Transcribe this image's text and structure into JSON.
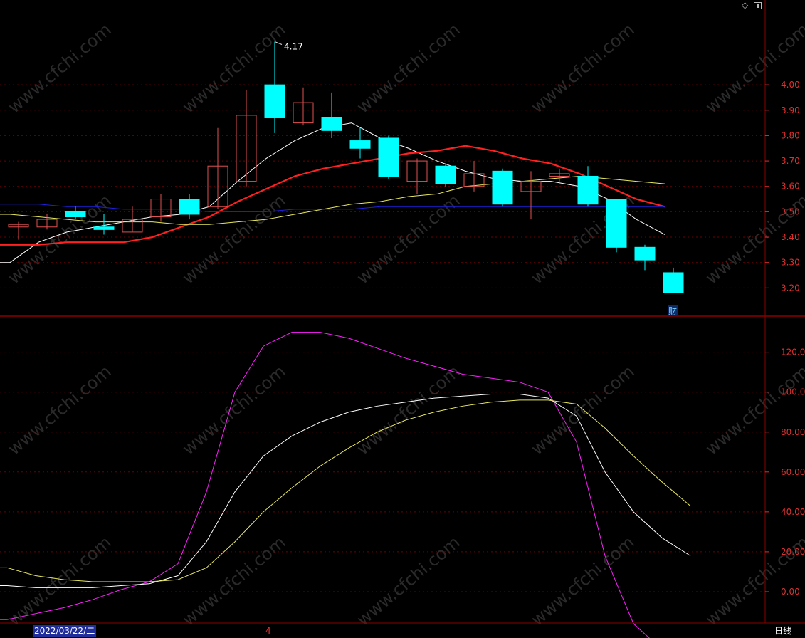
{
  "colors": {
    "background": "#000000",
    "frame": "#8b0000",
    "grid": "#6b0000",
    "axis_text": "#e03030",
    "up_candle": "#e05050",
    "down_candle": "#00ffff",
    "ma_white": "#ffffff",
    "ma_red": "#ff2020",
    "ma_yellow": "#e8e860",
    "ma_blue": "#2020e0",
    "ind_magenta": "#ff20ff",
    "ind_white": "#ffffff",
    "ind_yellow": "#e8e860",
    "watermark": "#2a2a2a"
  },
  "toolbar": {
    "icon_diamond": "diamond-icon",
    "icon_panel": "panel-icon"
  },
  "bottom_bar": {
    "date": "2022/03/22/二",
    "month_marker": "4",
    "period": "日线"
  },
  "watermark": "www.cfchi.com",
  "chart_data": [
    {
      "type": "candlestick",
      "ylim": [
        3.1,
        4.25
      ],
      "yticks": [
        "4.00",
        "3.90",
        "3.80",
        "3.70",
        "3.60",
        "3.50",
        "3.40",
        "3.30",
        "3.20"
      ],
      "ytick_values": [
        4.0,
        3.9,
        3.8,
        3.7,
        3.6,
        3.5,
        3.4,
        3.3,
        3.2
      ],
      "annotation": {
        "text": "4.17",
        "candle_index": 9
      },
      "event_marker": {
        "text": "财",
        "candle_index": 23
      },
      "candles": [
        {
          "o": 3.44,
          "h": 3.46,
          "l": 3.39,
          "c": 3.45
        },
        {
          "o": 3.44,
          "h": 3.49,
          "l": 3.43,
          "c": 3.47
        },
        {
          "o": 3.5,
          "h": 3.52,
          "l": 3.47,
          "c": 3.48
        },
        {
          "o": 3.44,
          "h": 3.49,
          "l": 3.41,
          "c": 3.43
        },
        {
          "o": 3.42,
          "h": 3.52,
          "l": 3.42,
          "c": 3.47
        },
        {
          "o": 3.48,
          "h": 3.57,
          "l": 3.46,
          "c": 3.55
        },
        {
          "o": 3.55,
          "h": 3.57,
          "l": 3.47,
          "c": 3.49
        },
        {
          "o": 3.52,
          "h": 3.83,
          "l": 3.51,
          "c": 3.68
        },
        {
          "o": 3.62,
          "h": 3.98,
          "l": 3.6,
          "c": 3.88
        },
        {
          "o": 4.0,
          "h": 4.17,
          "l": 3.81,
          "c": 3.87
        },
        {
          "o": 3.85,
          "h": 3.99,
          "l": 3.84,
          "c": 3.93
        },
        {
          "o": 3.87,
          "h": 3.97,
          "l": 3.79,
          "c": 3.82
        },
        {
          "o": 3.78,
          "h": 3.83,
          "l": 3.71,
          "c": 3.75
        },
        {
          "o": 3.79,
          "h": 3.8,
          "l": 3.63,
          "c": 3.64
        },
        {
          "o": 3.62,
          "h": 3.71,
          "l": 3.57,
          "c": 3.7
        },
        {
          "o": 3.68,
          "h": 3.69,
          "l": 3.6,
          "c": 3.61
        },
        {
          "o": 3.6,
          "h": 3.7,
          "l": 3.58,
          "c": 3.65
        },
        {
          "o": 3.66,
          "h": 3.67,
          "l": 3.52,
          "c": 3.53
        },
        {
          "o": 3.58,
          "h": 3.66,
          "l": 3.47,
          "c": 3.62
        },
        {
          "o": 3.64,
          "h": 3.67,
          "l": 3.62,
          "c": 3.65
        },
        {
          "o": 3.64,
          "h": 3.68,
          "l": 3.52,
          "c": 3.53
        },
        {
          "o": 3.55,
          "h": 3.55,
          "l": 3.34,
          "c": 3.36
        },
        {
          "o": 3.36,
          "h": 3.37,
          "l": 3.27,
          "c": 3.31
        },
        {
          "o": 3.26,
          "h": 3.28,
          "l": 3.18,
          "c": 3.18
        }
      ],
      "series": [
        {
          "color_key": "ma_white",
          "values": [
            3.3,
            3.38,
            3.42,
            3.44,
            3.46,
            3.48,
            3.49,
            3.52,
            3.62,
            3.71,
            3.78,
            3.83,
            3.85,
            3.79,
            3.75,
            3.7,
            3.66,
            3.63,
            3.62,
            3.62,
            3.6,
            3.55,
            3.47,
            3.41
          ]
        },
        {
          "color_key": "ma_red",
          "values": [
            3.37,
            3.37,
            3.38,
            3.38,
            3.38,
            3.4,
            3.44,
            3.48,
            3.54,
            3.59,
            3.64,
            3.67,
            3.69,
            3.71,
            3.73,
            3.74,
            3.76,
            3.74,
            3.71,
            3.69,
            3.65,
            3.6,
            3.55,
            3.52
          ]
        },
        {
          "color_key": "ma_yellow",
          "values": [
            3.49,
            3.48,
            3.47,
            3.46,
            3.46,
            3.46,
            3.45,
            3.45,
            3.46,
            3.47,
            3.49,
            3.51,
            3.53,
            3.54,
            3.56,
            3.57,
            3.6,
            3.61,
            3.62,
            3.63,
            3.64,
            3.63,
            3.62,
            3.61
          ]
        },
        {
          "color_key": "ma_blue",
          "values": [
            3.53,
            3.53,
            3.52,
            3.52,
            3.51,
            3.51,
            3.51,
            3.5,
            3.5,
            3.5,
            3.51,
            3.51,
            3.51,
            3.52,
            3.52,
            3.52,
            3.52,
            3.52,
            3.52,
            3.52,
            3.52,
            3.52,
            3.52,
            3.52
          ]
        }
      ]
    },
    {
      "type": "line",
      "ylim": [
        -15,
        137
      ],
      "yticks": [
        "120.0",
        "100.0",
        "80.00",
        "60.00",
        "40.00",
        "20.00",
        "0.00"
      ],
      "ytick_values": [
        120,
        100,
        80,
        60,
        40,
        20,
        0
      ],
      "series": [
        {
          "color_key": "ind_magenta",
          "values": [
            -14,
            -11,
            -8,
            -4,
            1,
            5,
            14,
            50,
            100,
            123,
            130,
            130,
            127,
            122,
            117,
            113,
            109,
            107,
            105,
            100,
            75,
            18,
            -16,
            -29,
            -32
          ]
        },
        {
          "color_key": "ind_white",
          "values": [
            3,
            2,
            2,
            2,
            3,
            4,
            8,
            25,
            50,
            68,
            78,
            85,
            90,
            93,
            95,
            97,
            98,
            99,
            99,
            97,
            88,
            60,
            40,
            27,
            18
          ]
        },
        {
          "color_key": "ind_yellow",
          "values": [
            12,
            8,
            6,
            5,
            5,
            5,
            6,
            12,
            25,
            40,
            52,
            63,
            72,
            80,
            86,
            90,
            93,
            95,
            96,
            96,
            94,
            82,
            68,
            55,
            43
          ]
        }
      ]
    }
  ]
}
